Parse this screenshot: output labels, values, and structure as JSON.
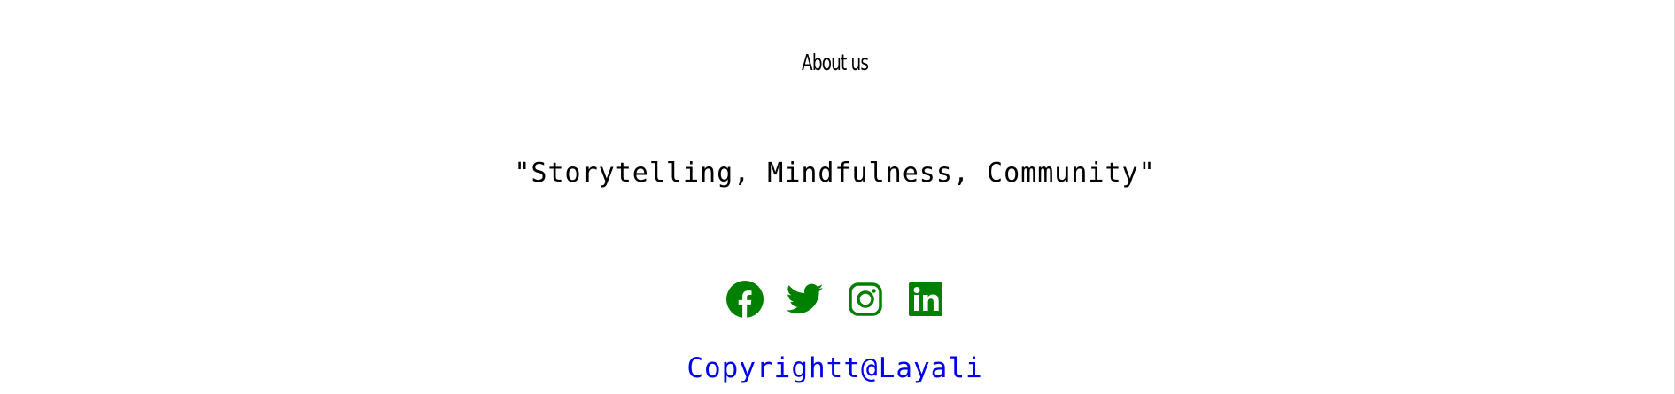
{
  "footer": {
    "about_label": "About us",
    "tagline": "\"Storytelling, Mindfulness, Community\"",
    "copyright": "Copyrightt@Layali",
    "social_links": [
      {
        "icon": "facebook-icon"
      },
      {
        "icon": "twitter-icon"
      },
      {
        "icon": "instagram-icon"
      },
      {
        "icon": "linkedin-icon"
      }
    ]
  },
  "colors": {
    "icon": "#008000",
    "copyright": "#0000ee",
    "text": "#000000",
    "background": "#ffffff"
  }
}
